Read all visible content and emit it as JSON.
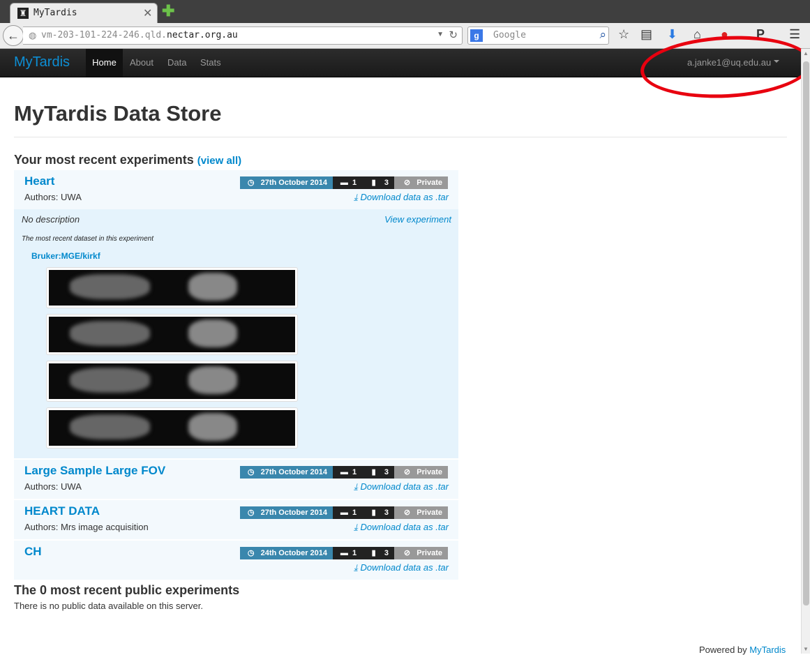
{
  "browser": {
    "tab_title": "MyTardis",
    "url_prefix": "vm-203-101-224-246.qld.",
    "url_domain": "nectar.org.au",
    "search_placeholder": "Google"
  },
  "navbar": {
    "brand": "MyTardis",
    "links": [
      "Home",
      "About",
      "Data",
      "Stats"
    ],
    "user": "a.janke1@uq.edu.au"
  },
  "page": {
    "title": "MyTardis Data Store",
    "recent_heading": "Your most recent experiments",
    "view_all": "view all",
    "download_label": "Download data as .tar",
    "private_label": "Private",
    "experiments": [
      {
        "title": "Heart",
        "authors": "Authors: UWA",
        "date": "27th October 2014",
        "datasets": "1",
        "files": "3"
      },
      {
        "title": "Large Sample Large FOV",
        "authors": "Authors: UWA",
        "date": "27th October 2014",
        "datasets": "1",
        "files": "3"
      },
      {
        "title": "HEART DATA",
        "authors": "Authors: Mrs image acquisition",
        "date": "27th October 2014",
        "datasets": "1",
        "files": "3"
      },
      {
        "title": "CH",
        "authors": "",
        "date": "24th October 2014",
        "datasets": "1",
        "files": "3"
      }
    ],
    "detail": {
      "no_description": "No description",
      "view_experiment": "View experiment",
      "recent_dataset": "The most recent dataset in this experiment",
      "dataset_name": "Bruker:MGE/kirkf"
    },
    "public_heading": "The 0 most recent public experiments",
    "public_text": "There is no public data available on this server.",
    "footer_text": "Powered by",
    "footer_link": "MyTardis"
  },
  "colors": {
    "accent": "#0088cc",
    "date_badge": "#3a87ad",
    "annotation": "#e8000f"
  }
}
